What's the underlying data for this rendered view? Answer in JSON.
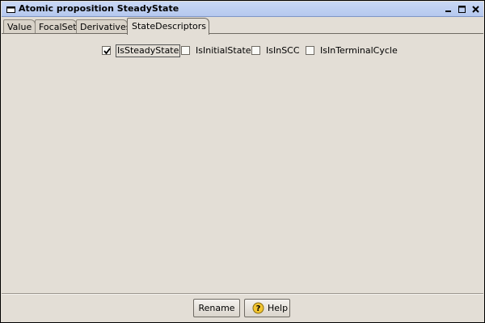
{
  "window": {
    "title": "Atomic proposition SteadyState",
    "icon": "window-icon",
    "controls": [
      "minimize-icon",
      "maximize-icon",
      "close-icon"
    ]
  },
  "tabs": [
    {
      "label": "Value",
      "active": false
    },
    {
      "label": "FocalSet",
      "active": false
    },
    {
      "label": "Derivatives",
      "active": false
    },
    {
      "label": "StateDescriptors",
      "active": true
    }
  ],
  "checkboxes": [
    {
      "label": "IsSteadyState",
      "checked": true,
      "focused": true
    },
    {
      "label": "IsInitialState",
      "checked": false
    },
    {
      "label": "IsInSCC",
      "checked": false
    },
    {
      "label": "IsInTerminalCycle",
      "checked": false
    }
  ],
  "buttons": {
    "rename_label": "Rename",
    "help_label": "Help",
    "help_icon": "question-icon"
  },
  "colors": {
    "background": "#e3ded6",
    "titlebar": "#c9d8f5",
    "help_icon": "#f2c531"
  }
}
